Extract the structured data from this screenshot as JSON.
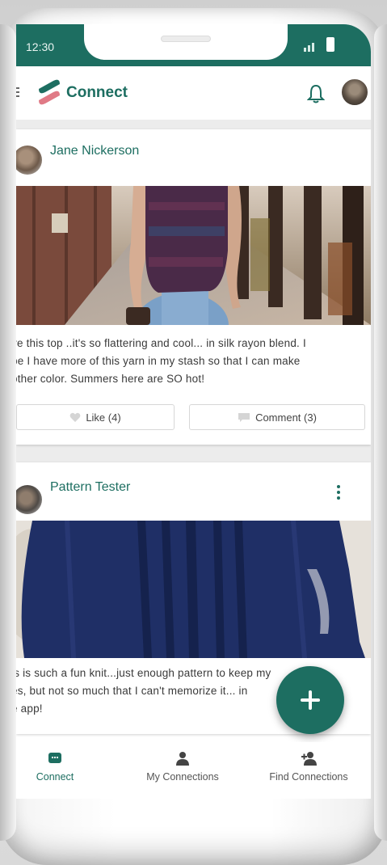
{
  "status_bar": {
    "time": "12:30"
  },
  "app_bar": {
    "title": "Connect"
  },
  "posts": [
    {
      "author": "Jane Nickerson",
      "text_lines": [
        "ve this top ..it's so flattering and cool... in silk rayon blend. I",
        "pe I have more of this yarn in my stash so that I can make",
        "other color. Summers here are SO hot!"
      ],
      "like_label": "Like (4)",
      "comment_label": "Comment (3)"
    },
    {
      "author": "Pattern Tester",
      "text_lines": [
        "is is such a fun knit...just enough pattern to keep   my",
        "es, but not so much that I can't memorize it...   in",
        "e app!"
      ]
    }
  ],
  "bottom_nav": [
    {
      "label": "Connect",
      "icon": "chat-icon",
      "active": true
    },
    {
      "label": "My Connections",
      "icon": "person-icon",
      "active": false
    },
    {
      "label": "Find Connections",
      "icon": "person-add-icon",
      "active": false
    }
  ],
  "colors": {
    "primary": "#1d6e61",
    "logo_accent": "#e07a86",
    "feed_background": "#ececec"
  }
}
